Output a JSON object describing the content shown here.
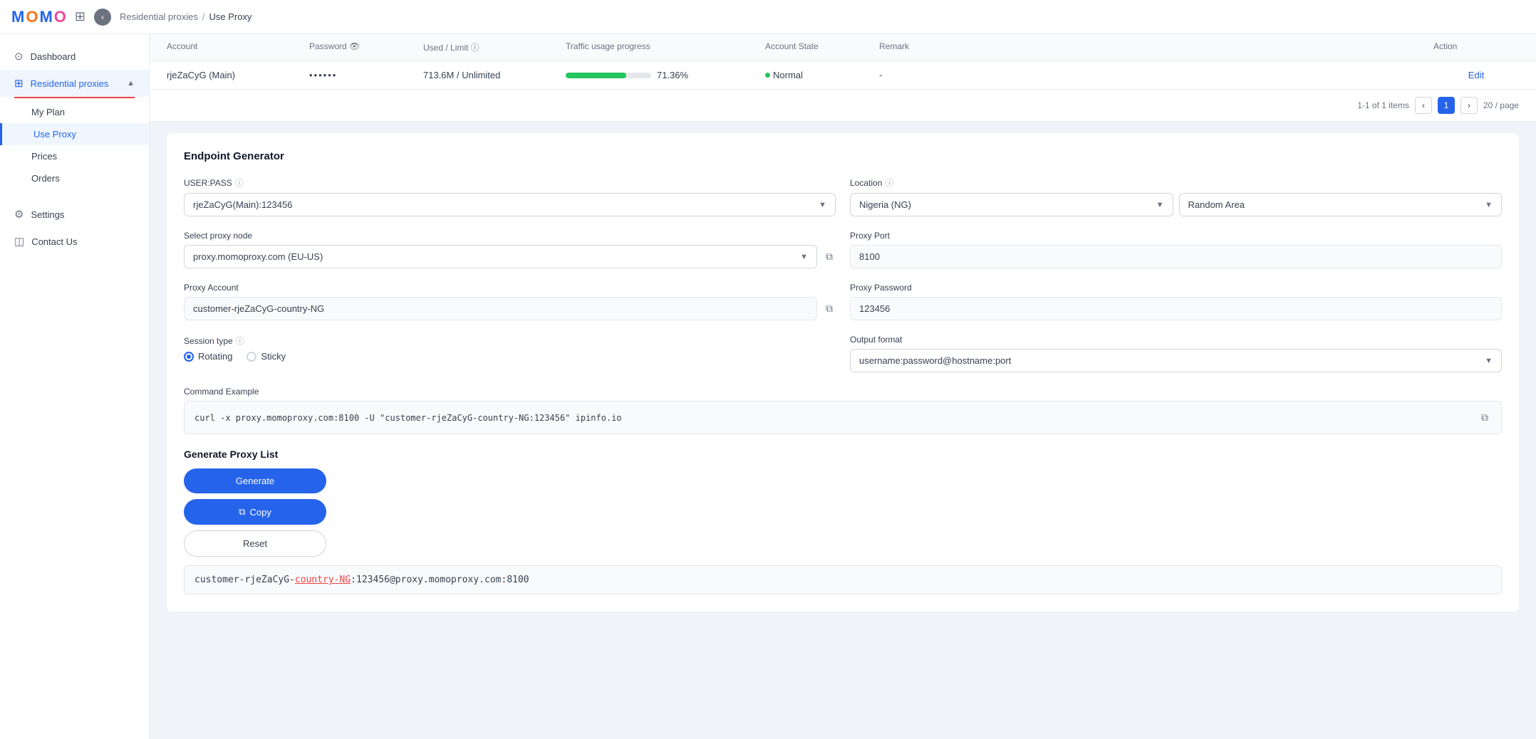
{
  "logo": {
    "letters": [
      "M",
      "O",
      "M",
      "O"
    ]
  },
  "topbar": {
    "breadcrumb_parent": "Residential proxies",
    "breadcrumb_sep": "/",
    "breadcrumb_current": "Use Proxy"
  },
  "sidebar": {
    "dashboard_label": "Dashboard",
    "residential_proxies_label": "Residential proxies",
    "my_plan_label": "My Plan",
    "use_proxy_label": "Use Proxy",
    "prices_label": "Prices",
    "orders_label": "Orders",
    "settings_label": "Settings",
    "contact_us_label": "Contact Us"
  },
  "accounts_table": {
    "columns": [
      "Account",
      "Password",
      "Used / Limit",
      "Traffic usage progress",
      "Account State",
      "Remark",
      "Action"
    ],
    "row": {
      "account": "rjeZaCyG (Main)",
      "password": "••••••",
      "used_limit": "713.6M / Unlimited",
      "progress_pct": 71,
      "progress_label": "71.36%",
      "state": "Normal",
      "remark": "-",
      "action": "Edit"
    },
    "pagination": "1-1 of 1 items",
    "page": "1",
    "per_page": "20 / page"
  },
  "endpoint_generator": {
    "title": "Endpoint Generator",
    "user_pass_label": "USER:PASS",
    "user_pass_value": "rjeZaCyG(Main):123456",
    "location_label": "Location",
    "country_value": "Nigeria (NG)",
    "area_value": "Random Area",
    "proxy_node_label": "Select proxy node",
    "proxy_node_value": "proxy.momoproxy.com (EU-US)",
    "proxy_port_label": "Proxy Port",
    "proxy_port_value": "8100",
    "proxy_account_label": "Proxy Account",
    "proxy_account_value": "customer-rjeZaCyG-country-NG",
    "proxy_password_label": "Proxy Password",
    "proxy_password_value": "123456",
    "session_type_label": "Session type",
    "session_rotating": "Rotating",
    "session_sticky": "Sticky",
    "output_format_label": "Output format",
    "output_format_value": "username:password@hostname:port",
    "command_example_label": "Command Example",
    "command_text": "curl -x proxy.momoproxy.com:8100 -U \"customer-rjeZaCyG-country-NG:123456\" ipinfo.io",
    "generate_proxy_list_label": "Generate Proxy List",
    "generate_btn": "Generate",
    "copy_btn": "Copy",
    "reset_btn": "Reset",
    "proxy_output": "customer-rjeZaCyG-country-NG:123456@proxy.momoproxy.com:8100"
  }
}
